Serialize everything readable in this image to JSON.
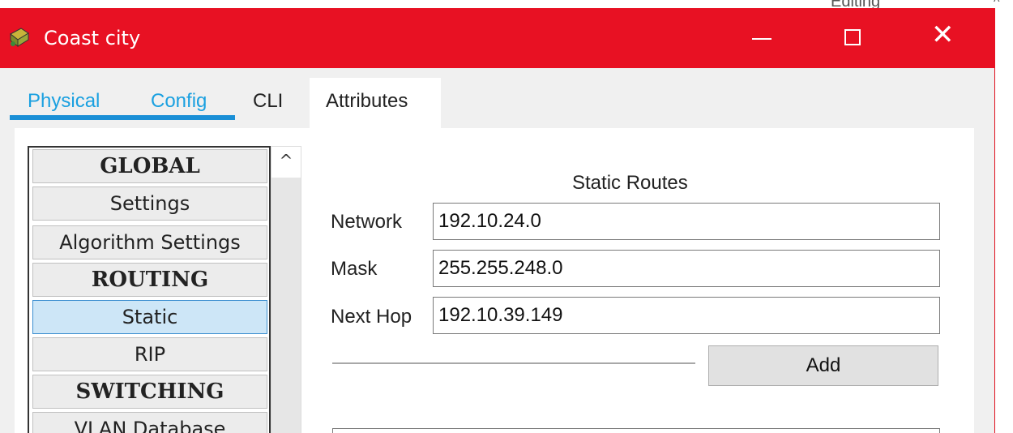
{
  "background": {
    "partial_text": "Editing"
  },
  "window": {
    "title": "Coast city",
    "title_bar_color": "#e81123"
  },
  "tabs": [
    {
      "label": "Physical"
    },
    {
      "label": "Config"
    },
    {
      "label": "CLI"
    },
    {
      "label": "Attributes"
    }
  ],
  "nav": {
    "items": [
      {
        "label": "GLOBAL"
      },
      {
        "label": "Settings"
      },
      {
        "label": "Algorithm Settings"
      },
      {
        "label": "ROUTING"
      },
      {
        "label": "Static"
      },
      {
        "label": "RIP"
      },
      {
        "label": "SWITCHING"
      },
      {
        "label": "VLAN Database"
      }
    ],
    "selected": "Static"
  },
  "static_routes": {
    "title": "Static Routes",
    "network_label": "Network",
    "network_value": "192.10.24.0",
    "mask_label": "Mask",
    "mask_value": "255.255.248.0",
    "next_hop_label": "Next Hop",
    "next_hop_value": "192.10.39.149",
    "add_label": "Add"
  }
}
